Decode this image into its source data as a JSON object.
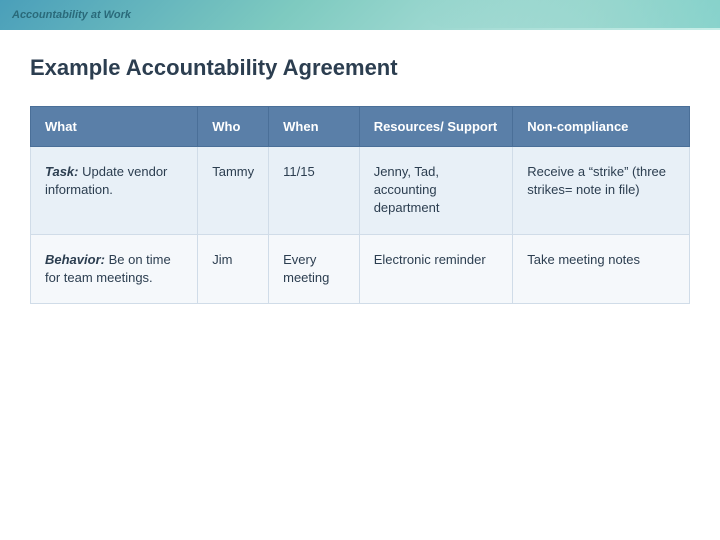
{
  "header": {
    "top_bar_title": "Accountability at Work",
    "decorative": true
  },
  "page": {
    "title": "Example Accountability Agreement"
  },
  "table": {
    "columns": [
      {
        "id": "what",
        "label": "What"
      },
      {
        "id": "who",
        "label": "Who"
      },
      {
        "id": "when",
        "label": "When"
      },
      {
        "id": "resources",
        "label": "Resources/ Support"
      },
      {
        "id": "noncompliance",
        "label": "Non-compliance"
      }
    ],
    "rows": [
      {
        "what_prefix": "Task:",
        "what_text": " Update vendor information.",
        "who": "Tammy",
        "when": "11/15",
        "resources": "Jenny, Tad, accounting department",
        "noncompliance": "Receive a “strike” (three strikes= note in file)"
      },
      {
        "what_prefix": "Behavior:",
        "what_text": " Be on time for team meetings.",
        "who": "Jim",
        "when": "Every meeting",
        "resources": "Electronic reminder",
        "noncompliance": "Take meeting notes"
      }
    ]
  }
}
